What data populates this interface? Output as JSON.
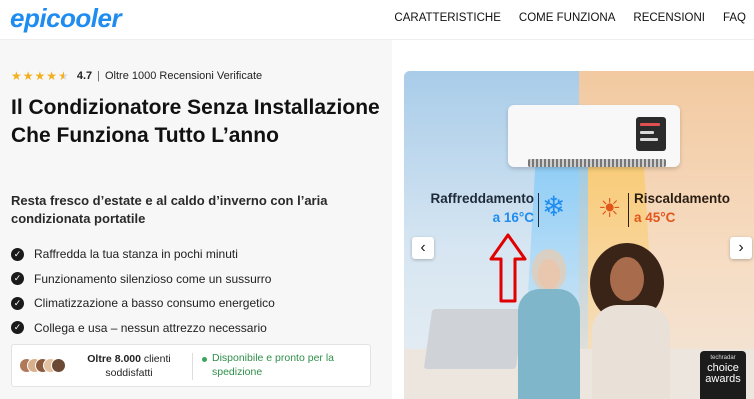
{
  "header": {
    "logo": "epicooler",
    "nav": [
      "CARATTERISTICHE",
      "COME FUNZIONA",
      "RECENSIONI",
      "FAQ"
    ]
  },
  "hero_left": {
    "rating": {
      "stars": 4.5,
      "value": "4.7",
      "separator": "|",
      "text": "Oltre 1000 Recensioni Verificate"
    },
    "title": "Il Condizionatore Senza Installazione Che Funziona Tutto L’anno",
    "subtitle": "Resta fresco d’estate e al caldo d’inverno con l’aria condizionata portatile",
    "features": [
      "Raffredda la tua stanza in pochi minuti",
      "Funzionamento silenzioso come un sussurro",
      "Climatizzazione a basso consumo energetico",
      "Collega e usa – nessun attrezzo necessario"
    ],
    "trust": {
      "clients_bold": "Oltre 8.000",
      "clients_rest": " clienti soddisfatti",
      "shipping": "Disponibile e pronto per la spedizione"
    }
  },
  "hero_image": {
    "cool_label": "Raffreddamento",
    "cool_temp": "a 16°C",
    "warm_label": "Riscaldamento",
    "warm_temp": "a 45°C",
    "badge_top": "techradar",
    "badge_main": "choice awards",
    "prev_icon": "chevron-left-icon",
    "next_icon": "chevron-right-icon"
  },
  "colors": {
    "brand": "#1f8cf0",
    "star": "#f2b01e",
    "warm": "#e0561b",
    "shipping": "#2f8f4a",
    "annotation_arrow": "#e00000"
  }
}
